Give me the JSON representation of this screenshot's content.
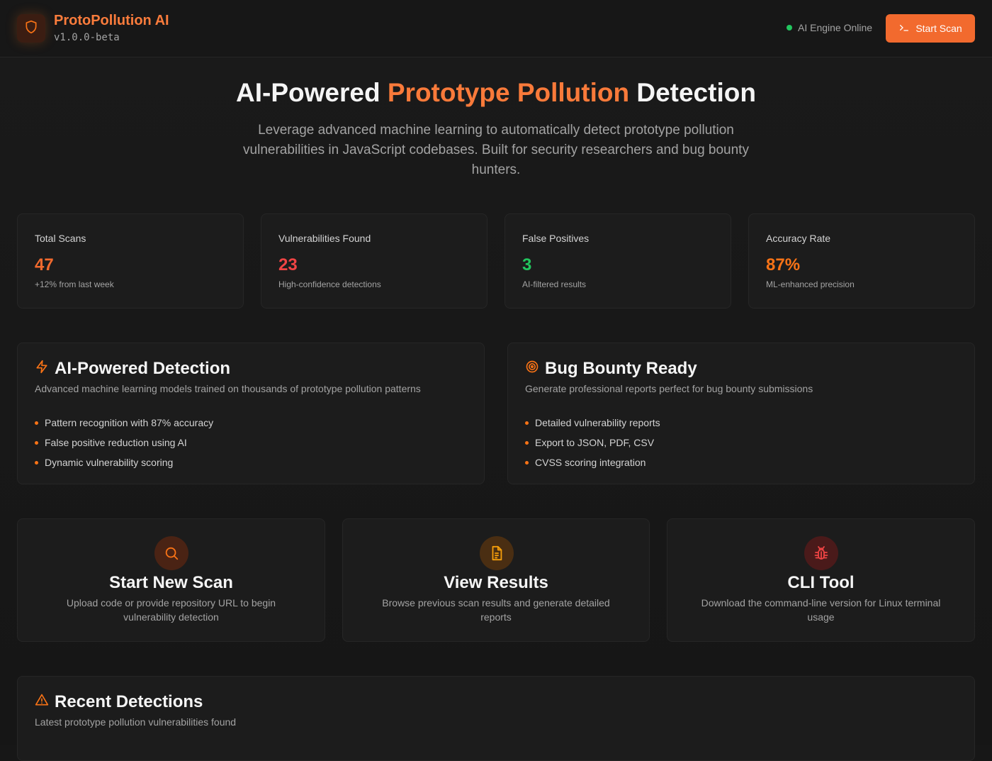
{
  "header": {
    "app_name": "ProtoPollution AI",
    "version": "v1.0.0-beta",
    "engine_status": "AI Engine Online",
    "start_scan_label": "Start Scan",
    "logo_icon": "shield-icon",
    "accent_color": "#f26a2e",
    "status_color": "#22c55e"
  },
  "hero": {
    "title_prefix": "AI-Powered ",
    "title_accent": "Prototype Pollution",
    "title_suffix": " Detection",
    "subtitle": "Leverage advanced machine learning to automatically detect prototype pollution vulnerabilities in JavaScript codebases. Built for security researchers and bug bounty hunters."
  },
  "stats": [
    {
      "label": "Total Scans",
      "value": "47",
      "note": "+12% from last week",
      "color": "#f26a2e"
    },
    {
      "label": "Vulnerabilities Found",
      "value": "23",
      "note": "High-confidence detections",
      "color": "#ef4444"
    },
    {
      "label": "False Positives",
      "value": "3",
      "note": "AI-filtered results",
      "color": "#22c55e"
    },
    {
      "label": "Accuracy Rate",
      "value": "87%",
      "note": "ML-enhanced precision",
      "color": "#f97316"
    }
  ],
  "features": [
    {
      "icon": "lightning-icon",
      "title": "AI-Powered Detection",
      "description": "Advanced machine learning models trained on thousands of prototype pollution patterns",
      "items": [
        "Pattern recognition with 87% accuracy",
        "False positive reduction using AI",
        "Dynamic vulnerability scoring"
      ]
    },
    {
      "icon": "target-icon",
      "title": "Bug Bounty Ready",
      "description": "Generate professional reports perfect for bug bounty submissions",
      "items": [
        "Detailed vulnerability reports",
        "Export to JSON, PDF, CSV",
        "CVSS scoring integration"
      ]
    }
  ],
  "actions": [
    {
      "icon": "search-icon",
      "title": "Start New Scan",
      "description": "Upload code or provide repository URL to begin vulnerability detection"
    },
    {
      "icon": "document-icon",
      "title": "View Results",
      "description": "Browse previous scan results and generate detailed reports"
    },
    {
      "icon": "bug-icon",
      "title": "CLI Tool",
      "description": "Download the command-line version for Linux terminal usage"
    }
  ],
  "recent": {
    "icon": "warning-icon",
    "title": "Recent Detections",
    "description": "Latest prototype pollution vulnerabilities found"
  }
}
